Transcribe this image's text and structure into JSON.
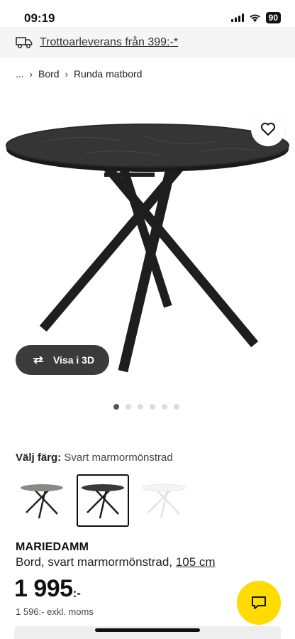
{
  "status_bar": {
    "time": "09:19",
    "battery": "90",
    "icons": [
      "signal-icon",
      "wifi-icon",
      "battery-icon"
    ]
  },
  "delivery_banner": {
    "icon": "truck-icon",
    "text": "Trottoarleverans från 399:-*"
  },
  "breadcrumb": {
    "items": [
      "...",
      "Bord",
      "Runda matbord"
    ]
  },
  "gallery": {
    "favorite_icon": "heart-icon",
    "view3d_label": "Visa i 3D",
    "view3d_icon": "rotate-icon",
    "total_images": 6,
    "active_index": 0
  },
  "color_selector": {
    "label": "Välj färg:",
    "selected_value": "Svart marmormönstrad",
    "options": [
      {
        "name": "grey-marble",
        "top_color": "#8a8987",
        "leg_color": "#222222"
      },
      {
        "name": "black-marble",
        "top_color": "#3a3a3a",
        "leg_color": "#1c1c1c"
      },
      {
        "name": "white",
        "top_color": "#f4f4f4",
        "leg_color": "#e6e6e6"
      }
    ],
    "selected_index": 1
  },
  "product": {
    "name": "MARIEDAMM",
    "description": "Bord, svart marmormönstrad,",
    "size": "105 cm",
    "price": "1 995",
    "price_suffix": ":-",
    "price_ex_vat": "1 596:- exkl. moms"
  },
  "chat_button": {
    "icon": "chat-icon",
    "color": "#ffdb00"
  },
  "colors": {
    "accent_yellow": "#ffdb00",
    "dark_button": "#3b3b3b"
  }
}
